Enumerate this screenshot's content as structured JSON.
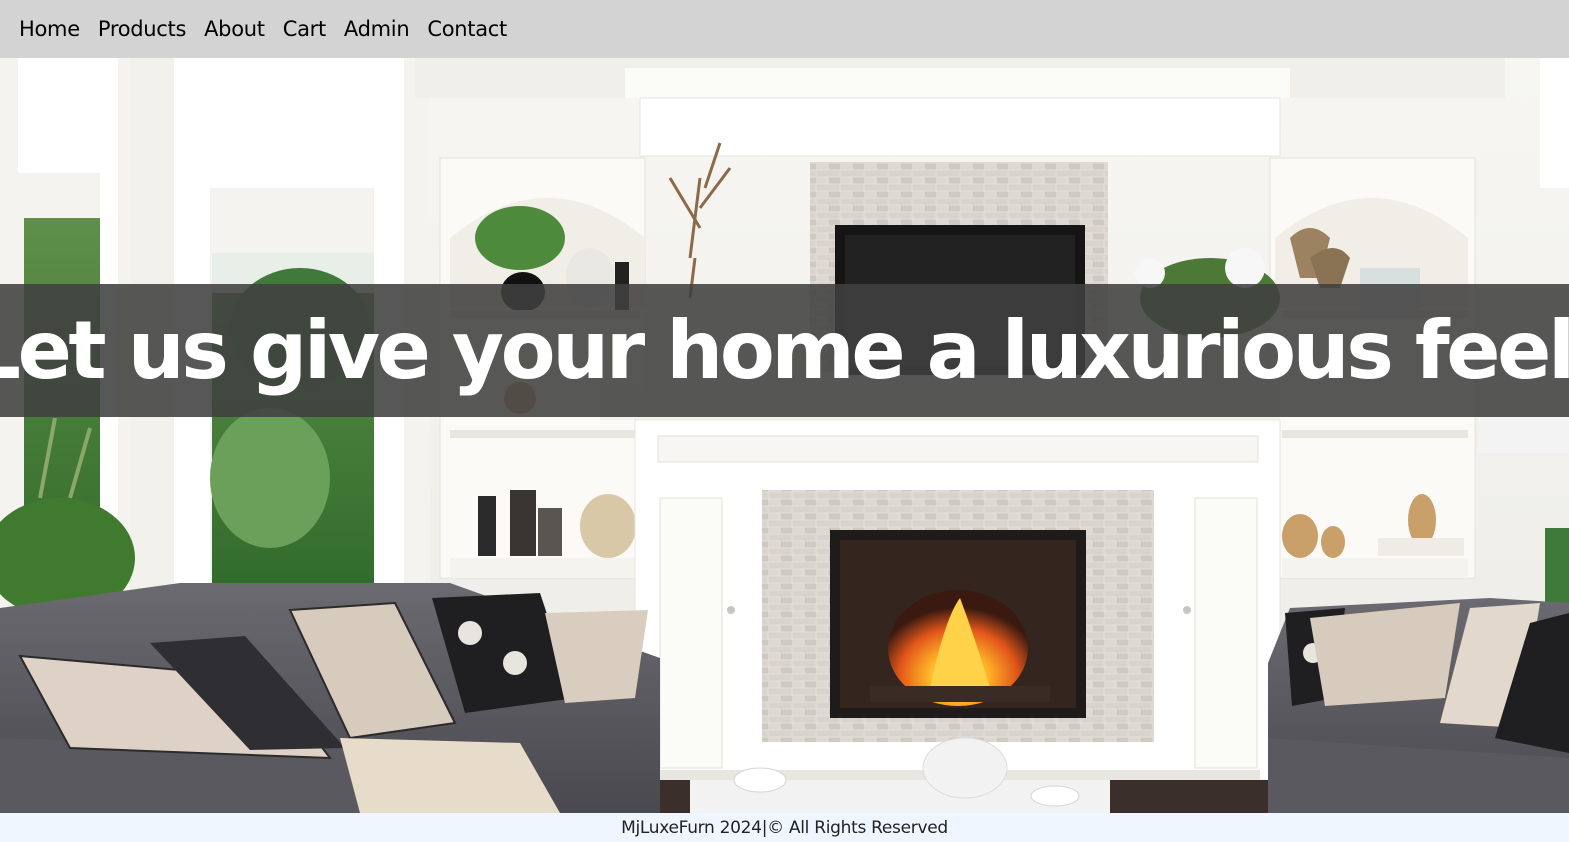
{
  "nav": {
    "items": [
      {
        "label": "Home"
      },
      {
        "label": "Products"
      },
      {
        "label": "About"
      },
      {
        "label": "Cart"
      },
      {
        "label": "Admin"
      },
      {
        "label": "Contact"
      }
    ]
  },
  "hero": {
    "headline": "Let us give your home a luxurious feel."
  },
  "footer": {
    "copyright": "MjLuxeFurn 2024|© All Rights Reserved"
  },
  "colors": {
    "nav_bg": "#d3d3d3",
    "banner_bg": "#404040",
    "footer_bg": "#f0f6ff"
  }
}
